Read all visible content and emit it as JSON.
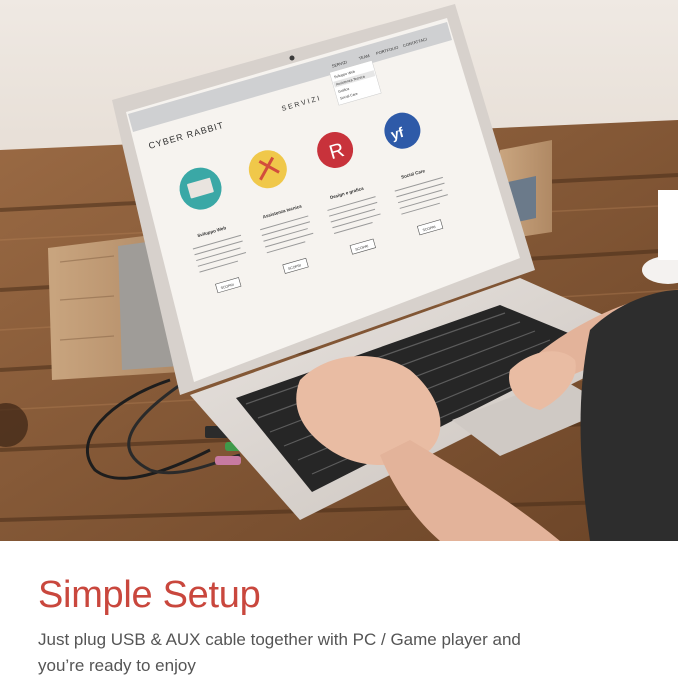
{
  "caption": {
    "headline": "Simple Setup",
    "subline_1": "Just plug USB & AUX cable together with PC / Game player and",
    "subline_2": "you’re ready to enjoy"
  },
  "screen_page": {
    "logo": "CYBER RABBIT",
    "section_title": "SERVIZI",
    "nav": [
      "SERVIZI",
      "TEAM",
      "PORTFOLIO",
      "CONTATTACI"
    ],
    "dropdown": [
      "Sviluppo Web",
      "Assistenza Tecnica",
      "Grafica",
      "Social Care"
    ],
    "services": [
      {
        "title": "Sviluppo Web",
        "button": "SCOPRI"
      },
      {
        "title": "Assistenza tecnica",
        "button": "SCOPRI"
      },
      {
        "title": "Design e grafica",
        "button": "SCOPRI"
      },
      {
        "title": "Social Care",
        "button": "SCOPRI"
      }
    ]
  },
  "colors": {
    "accent": "#c9473d",
    "body_text": "#555555",
    "wood": "#8b5a34",
    "aluminum": "#d9d3cf"
  },
  "icons": [
    "laptop",
    "speaker",
    "hands",
    "usb-cable",
    "aux-cable",
    "coffee-cup"
  ]
}
